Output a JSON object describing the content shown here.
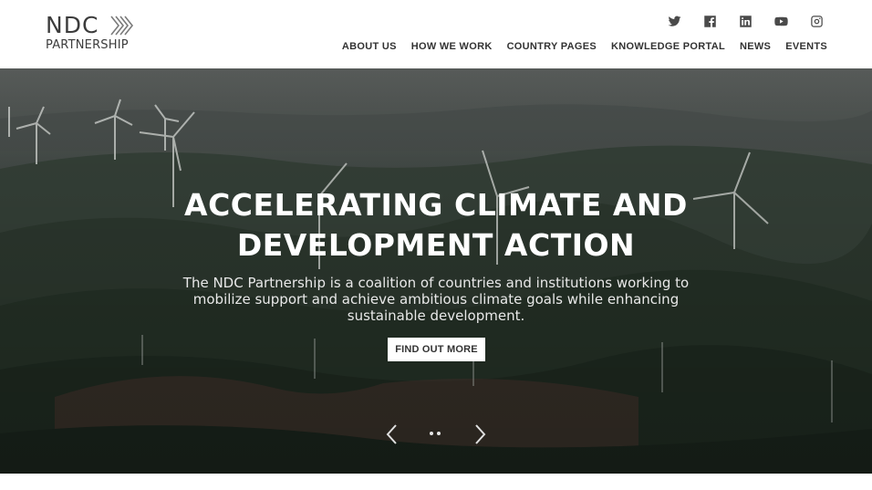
{
  "logo": {
    "line1": "NDC",
    "line2": "PARTNERSHIP"
  },
  "social": [
    {
      "icon": "twitter-icon"
    },
    {
      "icon": "facebook-icon"
    },
    {
      "icon": "linkedin-icon"
    },
    {
      "icon": "youtube-icon"
    },
    {
      "icon": "instagram-icon"
    }
  ],
  "nav": {
    "items": [
      "ABOUT US",
      "HOW WE WORK",
      "COUNTRY PAGES",
      "KNOWLEDGE PORTAL",
      "NEWS",
      "EVENTS"
    ]
  },
  "hero": {
    "title_line1": "ACCELERATING CLIMATE AND",
    "title_line2": "DEVELOPMENT ACTION",
    "subtitle": "The NDC Partnership is a coalition of countries and institutions working to mobilize support and achieve ambitious climate goals while enhancing sustainable development.",
    "button_label": "FIND OUT MORE",
    "slides": 2
  },
  "colors": {
    "text_dark": "#333333",
    "hero_overlay": "#1f2a22",
    "button_bg": "#ffffff"
  }
}
